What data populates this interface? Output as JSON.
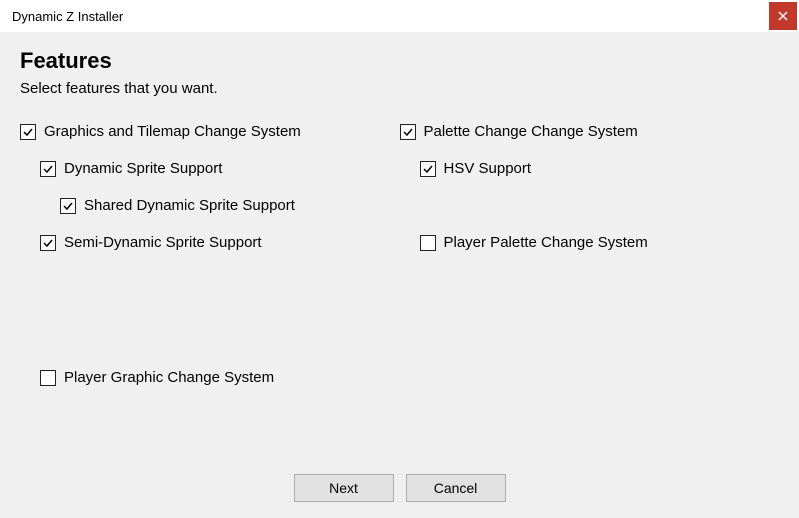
{
  "window": {
    "title": "Dynamic Z Installer"
  },
  "page": {
    "heading": "Features",
    "subheading": "Select features that you want."
  },
  "options": {
    "graphics_tilemap": {
      "label": "Graphics and Tilemap Change System",
      "checked": true
    },
    "dynamic_sprite": {
      "label": "Dynamic Sprite Support",
      "checked": true
    },
    "shared_dynamic_sprite": {
      "label": "Shared Dynamic Sprite Support",
      "checked": true
    },
    "semi_dynamic_sprite": {
      "label": "Semi-Dynamic Sprite Support",
      "checked": true
    },
    "player_graphic_change": {
      "label": "Player Graphic Change System",
      "checked": false
    },
    "palette_change": {
      "label": "Palette Change Change System",
      "checked": true
    },
    "hsv_support": {
      "label": "HSV Support",
      "checked": true
    },
    "player_palette_change": {
      "label": "Player Palette Change System",
      "checked": false
    }
  },
  "buttons": {
    "next": "Next",
    "cancel": "Cancel"
  }
}
